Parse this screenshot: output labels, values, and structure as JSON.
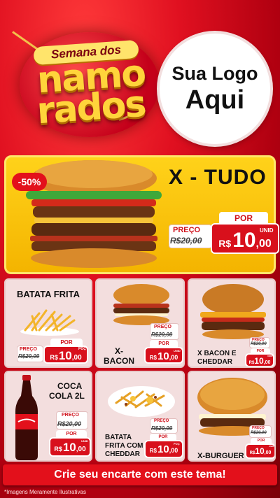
{
  "header": {
    "title_small": "Semana dos",
    "title_line1": "namo",
    "title_line2": "rados",
    "logo_line1": "Sua Logo",
    "logo_line2": "Aqui"
  },
  "hero": {
    "discount": "-50%",
    "title": "X - TUDO",
    "price": {
      "label_old": "PREÇO",
      "old": "R$20,00",
      "label_new": "POR",
      "currency": "R$",
      "int": "10",
      "dec": ",00",
      "unit": "UNID"
    }
  },
  "products": [
    {
      "name": "BATATA FRITA",
      "price": {
        "label_old": "PREÇO",
        "old": "R$20,00",
        "label_new": "POR",
        "currency": "R$",
        "int": "10",
        "dec": ",00",
        "unit": "POÇ"
      }
    },
    {
      "name_line1": "X-",
      "name_line2": "BACON",
      "price": {
        "label_old": "PREÇO",
        "old": "R$20,00",
        "label_new": "POR",
        "currency": "R$",
        "int": "10",
        "dec": ",00",
        "unit": "UNID"
      }
    },
    {
      "name_line1": "X BACON E",
      "name_line2": "CHEDDAR",
      "price": {
        "label_old": "PREÇO",
        "old": "R$20,00",
        "label_new": "POR",
        "currency": "R$",
        "int": "10",
        "dec": ",00",
        "unit": "UNID"
      }
    },
    {
      "name_line1": "COCA",
      "name_line2": "COLA 2L",
      "price": {
        "label_old": "PREÇO",
        "old": "R$20,00",
        "label_new": "POR",
        "currency": "R$",
        "int": "10",
        "dec": ",00",
        "unit": "UNID"
      }
    },
    {
      "name_line1": "BATATA",
      "name_line2": "FRITA COM",
      "name_line3": "CHEDDAR",
      "price": {
        "label_old": "PREÇO",
        "old": "R$20,00",
        "label_new": "POR",
        "currency": "R$",
        "int": "10",
        "dec": ",00",
        "unit": "POÇ"
      }
    },
    {
      "name": "X-BURGUER",
      "price": {
        "label_old": "PREÇO",
        "old": "R$20,00",
        "label_new": "POR",
        "currency": "R$",
        "int": "10",
        "dec": ",00",
        "unit": "UNID"
      }
    }
  ],
  "banner": "Crie seu encarte com este tema!",
  "footnote": "*Imagens Meramente Ilustrativas"
}
